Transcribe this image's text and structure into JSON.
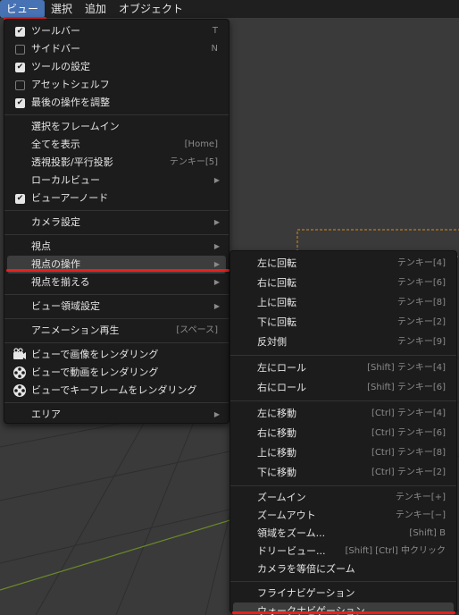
{
  "menubar": {
    "items": [
      "ビュー",
      "選択",
      "追加",
      "オブジェクト"
    ]
  },
  "view_menu": {
    "items": [
      {
        "label": "ツールバー",
        "shortcut": "T",
        "check": true
      },
      {
        "label": "サイドバー",
        "shortcut": "N",
        "check": false
      },
      {
        "label": "ツールの設定",
        "shortcut": "",
        "check": true
      },
      {
        "label": "アセットシェルフ",
        "shortcut": "",
        "check": false
      },
      {
        "label": "最後の操作を調整",
        "shortcut": "",
        "check": true
      },
      {
        "label": "選択をフレームイン",
        "shortcut": ""
      },
      {
        "label": "全てを表示",
        "shortcut": "[Home]"
      },
      {
        "label": "透視投影/平行投影",
        "shortcut": "テンキー[5]"
      },
      {
        "label": "ローカルビュー",
        "submenu": true
      },
      {
        "label": "ビューアーノード",
        "check": true
      },
      {
        "label": "カメラ設定",
        "submenu": true
      },
      {
        "label": "視点",
        "submenu": true
      },
      {
        "label": "視点の操作",
        "submenu": true
      },
      {
        "label": "視点を揃える",
        "submenu": true
      },
      {
        "label": "ビュー領域設定",
        "submenu": true
      },
      {
        "label": "アニメーション再生",
        "shortcut": "[スペース]"
      },
      {
        "label": "ビューで画像をレンダリング",
        "icon": "camera-icon"
      },
      {
        "label": "ビューで動画をレンダリング",
        "icon": "film-reel-icon"
      },
      {
        "label": "ビューでキーフレームをレンダリング",
        "icon": "film-reel-icon"
      },
      {
        "label": "エリア",
        "submenu": true
      }
    ]
  },
  "navigation_submenu": {
    "items": [
      {
        "label": "左に回転",
        "shortcut": "テンキー[4]"
      },
      {
        "label": "右に回転",
        "shortcut": "テンキー[6]"
      },
      {
        "label": "上に回転",
        "shortcut": "テンキー[8]"
      },
      {
        "label": "下に回転",
        "shortcut": "テンキー[2]"
      },
      {
        "label": "反対側",
        "shortcut": "テンキー[9]"
      },
      {
        "label": "左にロール",
        "shortcut": "[Shift] テンキー[4]"
      },
      {
        "label": "右にロール",
        "shortcut": "[Shift] テンキー[6]"
      },
      {
        "label": "左に移動",
        "shortcut": "[Ctrl] テンキー[4]"
      },
      {
        "label": "右に移動",
        "shortcut": "[Ctrl] テンキー[6]"
      },
      {
        "label": "上に移動",
        "shortcut": "[Ctrl] テンキー[8]"
      },
      {
        "label": "下に移動",
        "shortcut": "[Ctrl] テンキー[2]"
      },
      {
        "label": "ズームイン",
        "shortcut": "テンキー[+]"
      },
      {
        "label": "ズームアウト",
        "shortcut": "テンキー[−]"
      },
      {
        "label": "領域をズーム...",
        "shortcut": "[Shift] B"
      },
      {
        "label": "ドリービュー...",
        "shortcut": "[Shift] [Ctrl] 中クリック"
      },
      {
        "label": "カメラを等倍にズーム",
        "shortcut": ""
      },
      {
        "label": "フライナビゲーション",
        "shortcut": ""
      },
      {
        "label": "ウォークナビゲーション",
        "shortcut": ""
      }
    ]
  },
  "colors": {
    "accent": "#4772b3",
    "annotation": "#e8201c",
    "menu_bg": "#1c1c1c",
    "viewport_bg": "#3a3a3a"
  }
}
